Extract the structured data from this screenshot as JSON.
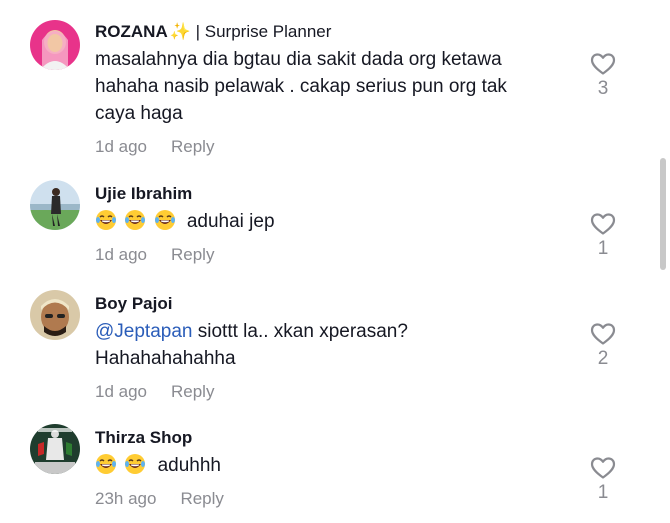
{
  "comments": [
    {
      "username": "ROZANA",
      "username_suffix": "| Surprise Planner",
      "lines": [
        "masalahnya dia bgtau dia sakit dada org ketawa",
        "hahaha nasib pelawak . cakap serius pun org tak",
        "caya haga"
      ],
      "time": "1d ago",
      "reply_label": "Reply",
      "likes": "3"
    },
    {
      "username": "Ujie Ibrahim",
      "text": "aduhai jep",
      "emoji_count": 3,
      "time": "1d ago",
      "reply_label": "Reply",
      "likes": "1"
    },
    {
      "username": "Boy Pajoi",
      "mention": "@Jeptapan",
      "text_after_mention": "siottt la.. xkan xperasan?",
      "line2": "Hahahahahahha",
      "time": "1d ago",
      "reply_label": "Reply",
      "likes": "2"
    },
    {
      "username": "Thirza Shop",
      "text": "aduhhh",
      "emoji_count": 2,
      "time": "23h ago",
      "reply_label": "Reply",
      "likes": "1"
    }
  ],
  "icons": {
    "like": "heart-outline-icon",
    "emoji": "laughing-tears-emoji",
    "sparkle": "sparkles-icon"
  },
  "colors": {
    "mention": "#2b5db9",
    "muted": "#8a8b91",
    "text": "#161823"
  }
}
